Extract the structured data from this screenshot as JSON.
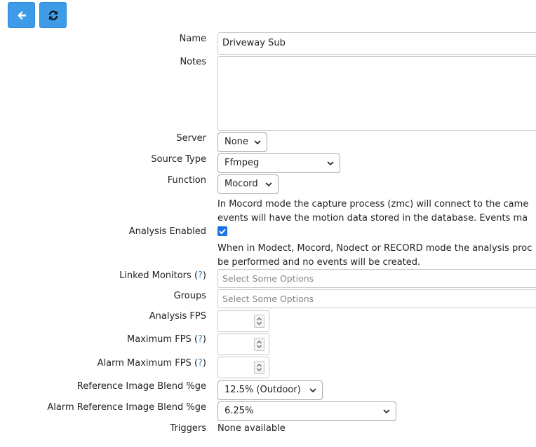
{
  "toolbar": {
    "back_icon": "arrow-left-icon",
    "refresh_icon": "refresh-icon",
    "accent": "#3d9be8"
  },
  "form": {
    "name_label": "Name",
    "name_value": "Driveway Sub",
    "notes_label": "Notes",
    "notes_value": "",
    "server_label": "Server",
    "server_value": "None",
    "source_type_label": "Source Type",
    "source_type_value": "Ffmpeg",
    "function_label": "Function",
    "function_value": "Mocord",
    "function_desc_line1": "In Mocord mode the capture process (zmc) will connect to the came",
    "function_desc_line2": "events will have the motion data stored in the database. Events ma",
    "analysis_enabled_label": "Analysis Enabled",
    "analysis_enabled_checked": true,
    "analysis_desc_line1": "When in Modect, Mocord, Nodect or RECORD mode the analysis proc",
    "analysis_desc_line2": "be performed and no events will be created.",
    "linked_monitors_label": "Linked Monitors",
    "help_open": "(",
    "help_mark": "?",
    "help_close": ")",
    "linked_monitors_placeholder": "Select Some Options",
    "groups_label": "Groups",
    "groups_placeholder": "Select Some Options",
    "analysis_fps_label": "Analysis FPS",
    "analysis_fps_value": "",
    "maximum_fps_label": "Maximum FPS",
    "maximum_fps_value": "",
    "alarm_maximum_fps_label": "Alarm Maximum FPS",
    "alarm_maximum_fps_value": "",
    "ref_blend_label": "Reference Image Blend %ge",
    "ref_blend_value": "12.5% (Outdoor)",
    "alarm_ref_blend_label": "Alarm Reference Image Blend %ge",
    "alarm_ref_blend_value": "6.25%",
    "triggers_label": "Triggers",
    "triggers_value": "None available"
  }
}
